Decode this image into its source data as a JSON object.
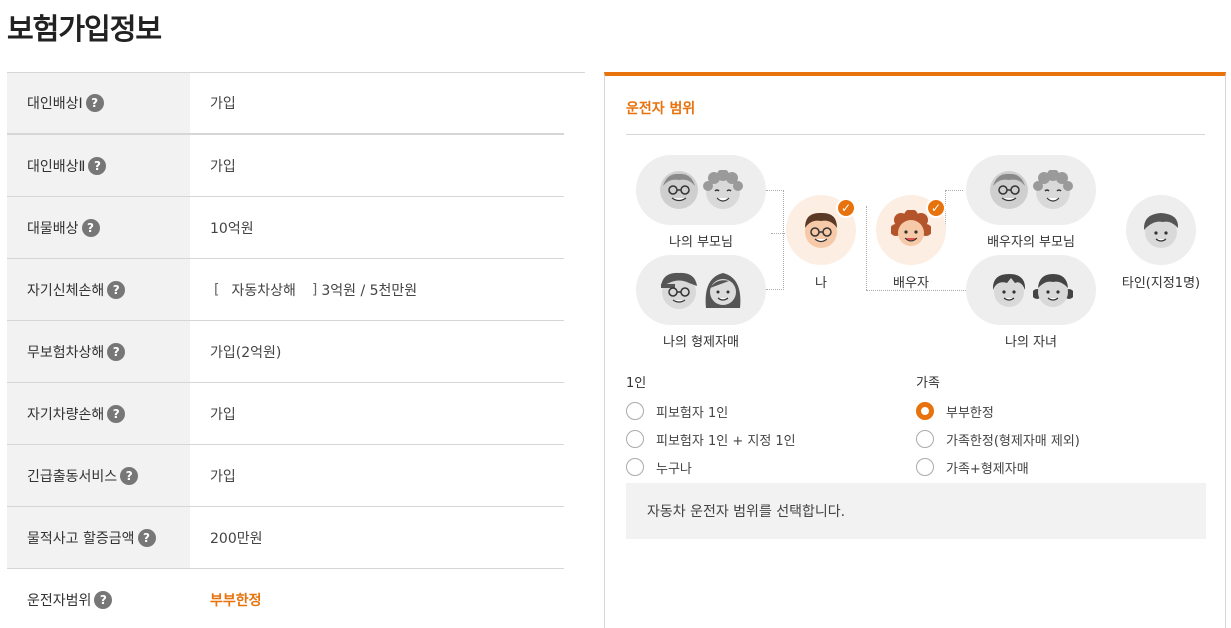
{
  "page": {
    "title": "보험가입정보"
  },
  "coverage": {
    "rows": [
      {
        "label": "대인배상Ⅰ",
        "value": "가입"
      },
      {
        "label": "대인배상Ⅱ",
        "value": "가입"
      },
      {
        "label": "대물배상",
        "value": "10억원"
      },
      {
        "label": "자기신체손해",
        "value_prefix": "[",
        "value_sub": "자동차상해",
        "value_suffix": "]",
        "value": "3억원 / 5천만원"
      },
      {
        "label": "무보험차상해",
        "value": "가입(2억원)"
      },
      {
        "label": "자기차량손해",
        "value": "가입"
      },
      {
        "label": "긴급출동서비스",
        "value": "가입"
      },
      {
        "label": "물적사고 할증금액",
        "value": "200만원"
      },
      {
        "label": "운전자범위",
        "value": "부부한정"
      }
    ],
    "help_glyph": "?"
  },
  "driver_scope": {
    "title": "운전자 범위",
    "nodes": {
      "my_parents": "나의 부모님",
      "my_siblings": "나의 형제자매",
      "me": "나",
      "spouse": "배우자",
      "spouse_parents": "배우자의 부모님",
      "my_children": "나의 자녀",
      "other": "타인(지정1명)"
    },
    "check_glyph": "✓",
    "groups": {
      "single": {
        "title": "1인",
        "options": [
          "피보험자 1인",
          "피보험자 1인 + 지정 1인",
          "누구나"
        ]
      },
      "family": {
        "title": "가족",
        "options": [
          "부부한정",
          "가족한정(형제자매 제외)",
          "가족+형제자매"
        ]
      }
    },
    "selected": "부부한정",
    "info_text": "자동차 운전자 범위를 선택합니다."
  },
  "colors": {
    "accent": "#e8720c",
    "row_label_bg": "#f2f2f2",
    "pill_bg": "#eeeeee"
  }
}
